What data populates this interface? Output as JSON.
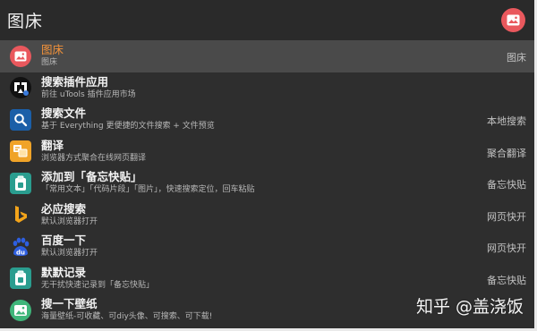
{
  "search": {
    "query": "图床"
  },
  "colors": {
    "accent": "#f0913a",
    "plugin_red": "#e9585d"
  },
  "results": [
    {
      "title": "图床",
      "subtitle": "图床",
      "right": "图床",
      "icon": "image-plugin-icon"
    },
    {
      "title": "搜索插件应用",
      "subtitle": "前往 uTools 插件应用市场",
      "right": "",
      "icon": "utools-logo-icon"
    },
    {
      "title": "搜索文件",
      "subtitle": "基于 Everything 更便捷的文件搜索 + 文件预览",
      "right": "本地搜索",
      "icon": "file-search-icon"
    },
    {
      "title": "翻译",
      "subtitle": "浏览器方式聚合在线网页翻译",
      "right": "聚合翻译",
      "icon": "translate-icon"
    },
    {
      "title": "添加到「备忘快贴」",
      "subtitle": "「常用文本」「代码片段」「图片」，快速搜索定位，回车粘贴",
      "right": "备忘快贴",
      "icon": "clipboard-icon"
    },
    {
      "title": "必应搜索",
      "subtitle": "默认浏览器打开",
      "right": "网页快开",
      "icon": "bing-icon"
    },
    {
      "title": "百度一下",
      "subtitle": "默认浏览器打开",
      "right": "网页快开",
      "icon": "baidu-icon"
    },
    {
      "title": "默默记录",
      "subtitle": "无干扰快速记录到「备忘快贴」",
      "right": "备忘快贴",
      "icon": "clipboard-icon"
    },
    {
      "title": "搜一下壁纸",
      "subtitle": "海量壁纸-可收藏、可diy头像、可搜索、可下载!",
      "right": "",
      "icon": "wallpaper-icon"
    }
  ],
  "watermark": "知乎 @盖浇饭"
}
